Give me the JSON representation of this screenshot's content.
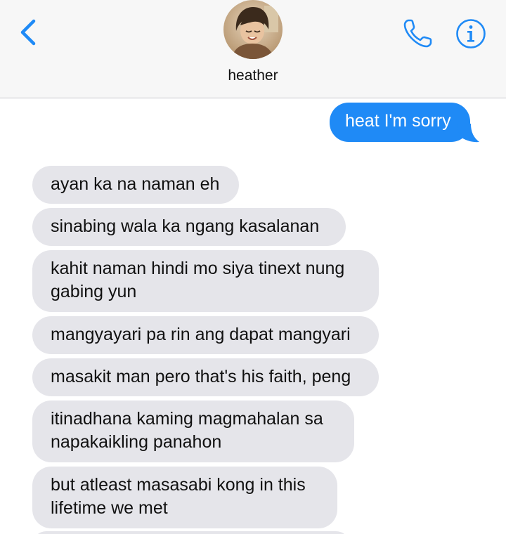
{
  "header": {
    "back_icon": "chevron-left-icon",
    "contact_name": "heather",
    "call_icon": "phone-icon",
    "info_icon": "info-icon",
    "accent_color": "#1f8af6"
  },
  "messages": [
    {
      "direction": "sent",
      "text": "heat I'm sorry"
    },
    {
      "direction": "received",
      "text": "ayan ka na naman eh"
    },
    {
      "direction": "received",
      "text": "sinabing wala ka ngang kasalanan"
    },
    {
      "direction": "received",
      "lines": [
        "kahit naman hindi mo siya tinext nung",
        "gabing yun"
      ]
    },
    {
      "direction": "received",
      "text": "mangyayari pa rin ang dapat mangyari"
    },
    {
      "direction": "received",
      "text": "masakit man pero that's his faith, peng"
    },
    {
      "direction": "received",
      "lines": [
        "itinadhana kaming magmahalan sa",
        "napakaikling panahon"
      ]
    },
    {
      "direction": "received",
      "lines": [
        "but atleast masasabi kong in this",
        "lifetime we met"
      ]
    }
  ],
  "colors": {
    "sent_bubble": "#1f8af6",
    "received_bubble": "#e5e5ea",
    "header_bg": "#f7f7f7"
  }
}
